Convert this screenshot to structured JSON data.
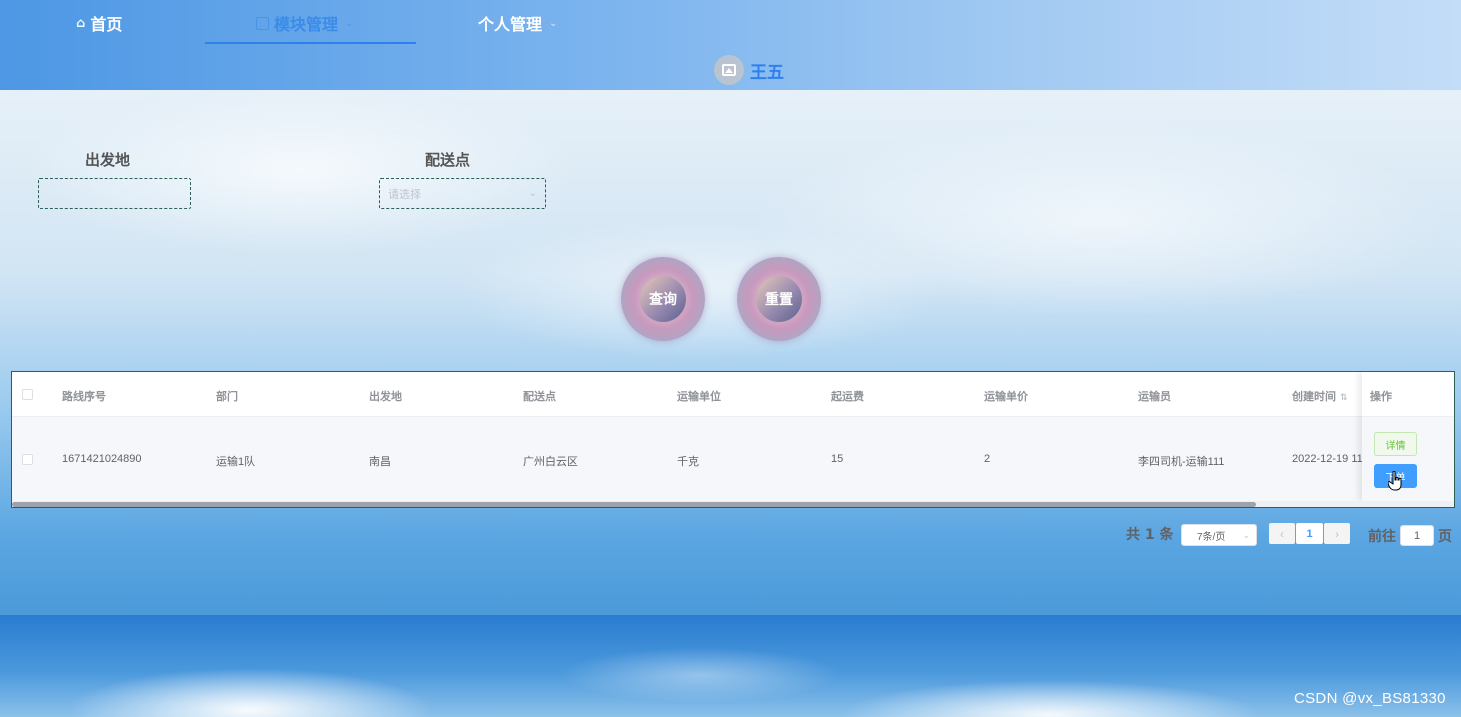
{
  "nav": {
    "items": [
      {
        "label": "首页",
        "icon": "home-icon",
        "active": false
      },
      {
        "label": "模块管理",
        "icon": "module-icon",
        "active": true,
        "dropdown": true
      },
      {
        "label": "个人管理",
        "dropdown": true,
        "active": false
      }
    ],
    "user_name": "王五",
    "colors": {
      "accent": "#2f80ed"
    }
  },
  "search": {
    "origin_label": "出发地",
    "origin_value": "",
    "delivery_label": "配送点",
    "delivery_placeholder": "请选择",
    "query_label": "查询",
    "reset_label": "重置"
  },
  "table": {
    "headers": [
      "路线序号",
      "部门",
      "出发地",
      "配送点",
      "运输单位",
      "起运费",
      "运输单价",
      "运输员",
      "创建时间",
      "操作"
    ],
    "rows": [
      [
        "1671421024890",
        "运输1队",
        "南昌",
        "广州白云区",
        "千克",
        "15",
        "2",
        "李四司机-运输111",
        "2022-12-19 11"
      ]
    ],
    "actions": {
      "detail_label": "详情",
      "order_label": "下单"
    }
  },
  "pagination": {
    "total_text": "共 1 条",
    "page_size": "7条/页",
    "prev": "‹",
    "current": "1",
    "next": "›",
    "goto_label": "前往",
    "goto_value": "1",
    "page_suffix": "页"
  },
  "watermark": "CSDN @vx_BS81330"
}
